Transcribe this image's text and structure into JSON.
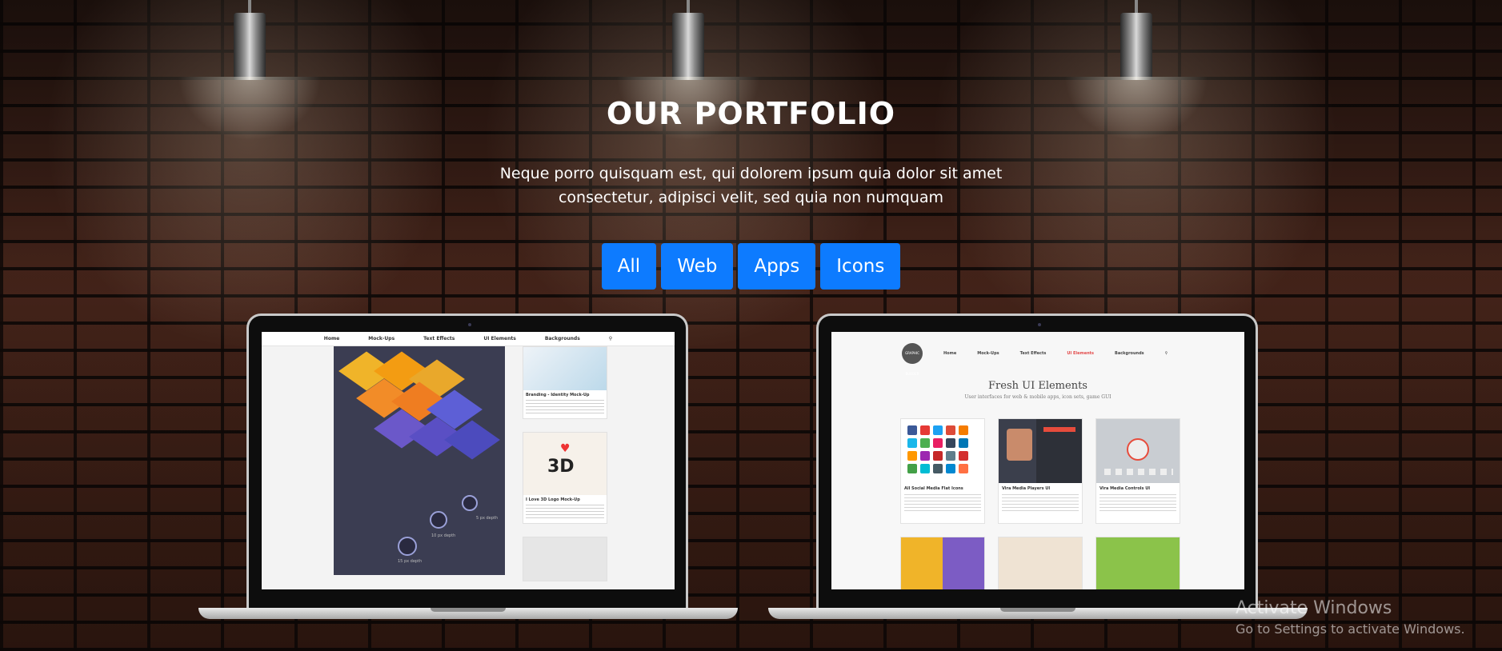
{
  "header": {
    "title": "OUR PORTFOLIO",
    "subtitle": "Neque porro quisquam est, qui dolorem ipsum quia dolor sit amet consectetur, adipisci velit, sed quia non numquam"
  },
  "filters": [
    {
      "label": "All"
    },
    {
      "label": "Web"
    },
    {
      "label": "Apps"
    },
    {
      "label": "Icons"
    }
  ],
  "colors": {
    "accent": "#0d7bff"
  },
  "portfolio": {
    "left": {
      "nav": [
        "Home",
        "Mock-Ups",
        "Text Effects",
        "UI Elements",
        "Backgrounds"
      ],
      "cards": [
        {
          "caption": "Branding - Identity Mock-Up"
        },
        {
          "caption": "I Love 3D Logo Mock-Up"
        }
      ],
      "depth_labels": [
        "5 px depth",
        "10 px depth",
        "15 px depth"
      ]
    },
    "right": {
      "logo": "GRAPHIC BURGER",
      "nav": [
        "Home",
        "Mock-Ups",
        "Text Effects",
        "UI Elements",
        "Backgrounds"
      ],
      "heading": "Fresh UI Elements",
      "subheading": "User interfaces for web & mobile apps, icon sets, game GUI",
      "cards": [
        {
          "caption": "All Social Media Flat Icons"
        },
        {
          "caption": "Vira Media Players UI"
        },
        {
          "caption": "Vira Media Controls UI"
        }
      ]
    }
  },
  "watermark": {
    "title": "Activate Windows",
    "subtitle": "Go to Settings to activate Windows."
  }
}
